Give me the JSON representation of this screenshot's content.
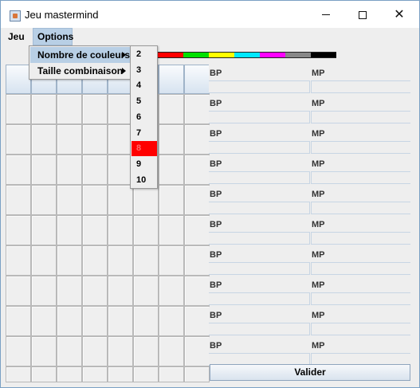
{
  "window": {
    "title": "Jeu mastermind",
    "controls": {
      "minimize": "minimize",
      "maximize": "maximize",
      "close": "✕"
    }
  },
  "menubar": {
    "items": [
      {
        "label": "Jeu"
      },
      {
        "label": "Options"
      }
    ]
  },
  "options_menu": {
    "items": [
      {
        "label": "Nombre de couleurs",
        "has_submenu": true,
        "highlighted": true
      },
      {
        "label": "Taille combinaison",
        "has_submenu": true,
        "highlighted": false
      }
    ]
  },
  "colors_submenu": {
    "items": [
      "2",
      "3",
      "4",
      "5",
      "6",
      "7",
      "8",
      "9",
      "10"
    ],
    "selected": "8",
    "selected_color": "#ff0000"
  },
  "palette": {
    "colors": [
      "#ff0000",
      "#00e000",
      "#ffff00",
      "#00e8ff",
      "#ff00ff",
      "#888888",
      "#000000"
    ]
  },
  "feedback": {
    "bp_label": "BP",
    "mp_label": "MP",
    "rows": 10
  },
  "actions": {
    "validate_label": "Valider"
  },
  "colors": {
    "selection_highlight": "#b8cfe5",
    "window_bg": "#eeeeee"
  }
}
